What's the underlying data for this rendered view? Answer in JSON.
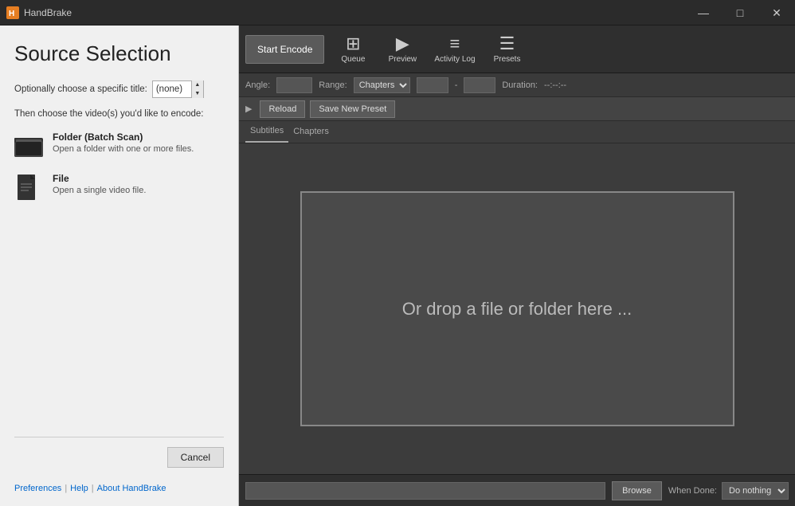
{
  "titleBar": {
    "appName": "HandBrake",
    "minBtn": "—",
    "maxBtn": "□",
    "closeBtn": "✕"
  },
  "sourcePanel": {
    "title": "Source Selection",
    "titleSelectLabel": "Optionally choose a specific title:",
    "titleSelectValue": "(none)",
    "encodeSubtitle": "Then choose the video(s) you'd like to encode:",
    "options": [
      {
        "title": "Folder (Batch Scan)",
        "desc": "Open a folder with one or more files."
      },
      {
        "title": "File",
        "desc": "Open a single video file."
      }
    ],
    "cancelLabel": "Cancel",
    "links": {
      "preferences": "Preferences",
      "help": "Help",
      "about": "About HandBrake"
    }
  },
  "toolbar": {
    "startEncode": "Start Encode",
    "buttons": [
      {
        "id": "queue",
        "label": "Queue",
        "icon": "⊞"
      },
      {
        "id": "preview",
        "label": "Preview",
        "icon": "▶"
      },
      {
        "id": "activity",
        "label": "Activity Log",
        "icon": "≡"
      },
      {
        "id": "presets",
        "label": "Presets",
        "icon": "☰"
      }
    ]
  },
  "controlsBar": {
    "angleLabel": "Angle:",
    "rangeLabel": "Range:",
    "rangeValue": "Chapters",
    "dashSep": "-",
    "durationLabel": "Duration:",
    "durationValue": "--:--:--"
  },
  "actionBar": {
    "reloadLabel": "Reload",
    "savePresetLabel": "Save New Preset"
  },
  "dropZone": {
    "text": "Or drop a file or folder here ..."
  },
  "bottomBar": {
    "browseLabel": "Browse",
    "whenDoneLabel": "When Done:",
    "whenDoneValue": "Do nothing"
  }
}
